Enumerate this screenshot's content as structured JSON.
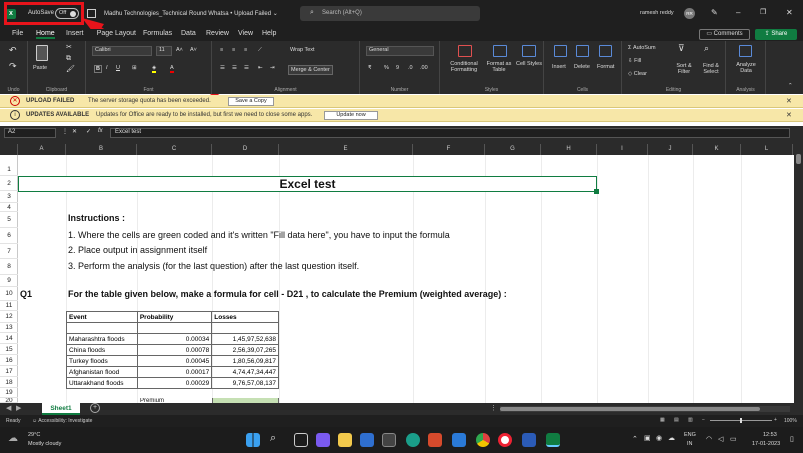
{
  "titlebar": {
    "autosave_label": "AutoSave",
    "autosave_state": "Off",
    "document_title": "Madhu Technologies_Technical Round Whatsa • Upload Failed ⌄",
    "search_placeholder": "Search (Alt+Q)",
    "user_name": "ramesh reddy",
    "user_initials": "RR"
  },
  "ribbon_tabs": [
    "File",
    "Home",
    "Insert",
    "Page Layout",
    "Formulas",
    "Data",
    "Review",
    "View",
    "Help"
  ],
  "comments_label": "Comments",
  "share_label": "Share",
  "ribbon": {
    "undo_label": "Undo",
    "paste_label": "Paste",
    "clipboard_label": "Clipboard",
    "font_name": "Calibri",
    "font_size": "11",
    "font_label": "Font",
    "alignment_label": "Alignment",
    "wrap_text": "Wrap Text",
    "merge_center": "Merge & Center",
    "number_format": "General",
    "number_label": "Number",
    "conditional_formatting": "Conditional Formatting",
    "format_as_table": "Format as Table",
    "cell_styles": "Cell Styles",
    "styles_label": "Styles",
    "insert": "Insert",
    "delete": "Delete",
    "format": "Format",
    "cells_label": "Cells",
    "autosum": "AutoSum",
    "fill": "Fill",
    "clear": "Clear",
    "sort_filter": "Sort & Filter",
    "find_select": "Find & Select",
    "editing_label": "Editing",
    "analyze_data": "Analyze Data",
    "analysis_label": "Analysis"
  },
  "messages": {
    "upload_failed_title": "UPLOAD FAILED",
    "upload_failed_text": "The server storage quota has been exceeded.",
    "save_copy": "Save a Copy",
    "updates_title": "UPDATES AVAILABLE",
    "updates_text": "Updates for Office are ready to be installed, but first we need to close some apps.",
    "update_now": "Update now"
  },
  "formula_bar": {
    "name_box": "A2",
    "fx": "fx",
    "content": "Excel test"
  },
  "columns": [
    "A",
    "B",
    "C",
    "D",
    "E",
    "F",
    "G",
    "H",
    "I",
    "J",
    "K",
    "L"
  ],
  "rows": [
    "1",
    "2",
    "3",
    "4",
    "5",
    "6",
    "7",
    "8",
    "9",
    "10",
    "11",
    "12",
    "13",
    "14",
    "15",
    "16",
    "17",
    "18",
    "19",
    "20"
  ],
  "sheet": {
    "title": "Excel test",
    "instructions_heading": "Instructions :",
    "instruction_1": "1. Where the cells are green coded and it's written \"Fill data here\", you have to input the formula",
    "instruction_2": "2. Place output in assignment itself",
    "instruction_3": "3. Perform the analysis (for the last question) after the last question itself.",
    "q1_label": "Q1",
    "q1_text": "For the table given below, make a formula for cell - D21 , to calculate the Premium (weighted average) :",
    "table_headers": [
      "Event",
      "Probability",
      "Losses"
    ],
    "table_rows": [
      [
        "Maharashtra floods",
        "0.00034",
        "1,45,97,52,638"
      ],
      [
        "China floods",
        "0.00078",
        "2,56,39,07,265"
      ],
      [
        "Turkey floods",
        "0.00045",
        "1,80,56,09,817"
      ],
      [
        "Afghanistan flood",
        "0.00017",
        "4,74,47,34,447"
      ],
      [
        "Uttarakhand floods",
        "0.00029",
        "9,76,57,08,137"
      ]
    ],
    "premium_label": "Premium"
  },
  "sheet_tab": "Sheet1",
  "status": {
    "ready": "Ready",
    "accessibility": "Accessibility: Investigate",
    "zoom": "100%"
  },
  "taskbar": {
    "weather_temp": "29°C",
    "weather_desc": "Mostly cloudy",
    "lang": "ENG",
    "region": "IN",
    "time": "12:53",
    "date": "17-01-2023"
  },
  "colors": {
    "excel_green": "#107c41",
    "highlight_red": "#e8141b",
    "message_bar": "#f7e7a8",
    "fill_green": "#c6e0b4"
  }
}
